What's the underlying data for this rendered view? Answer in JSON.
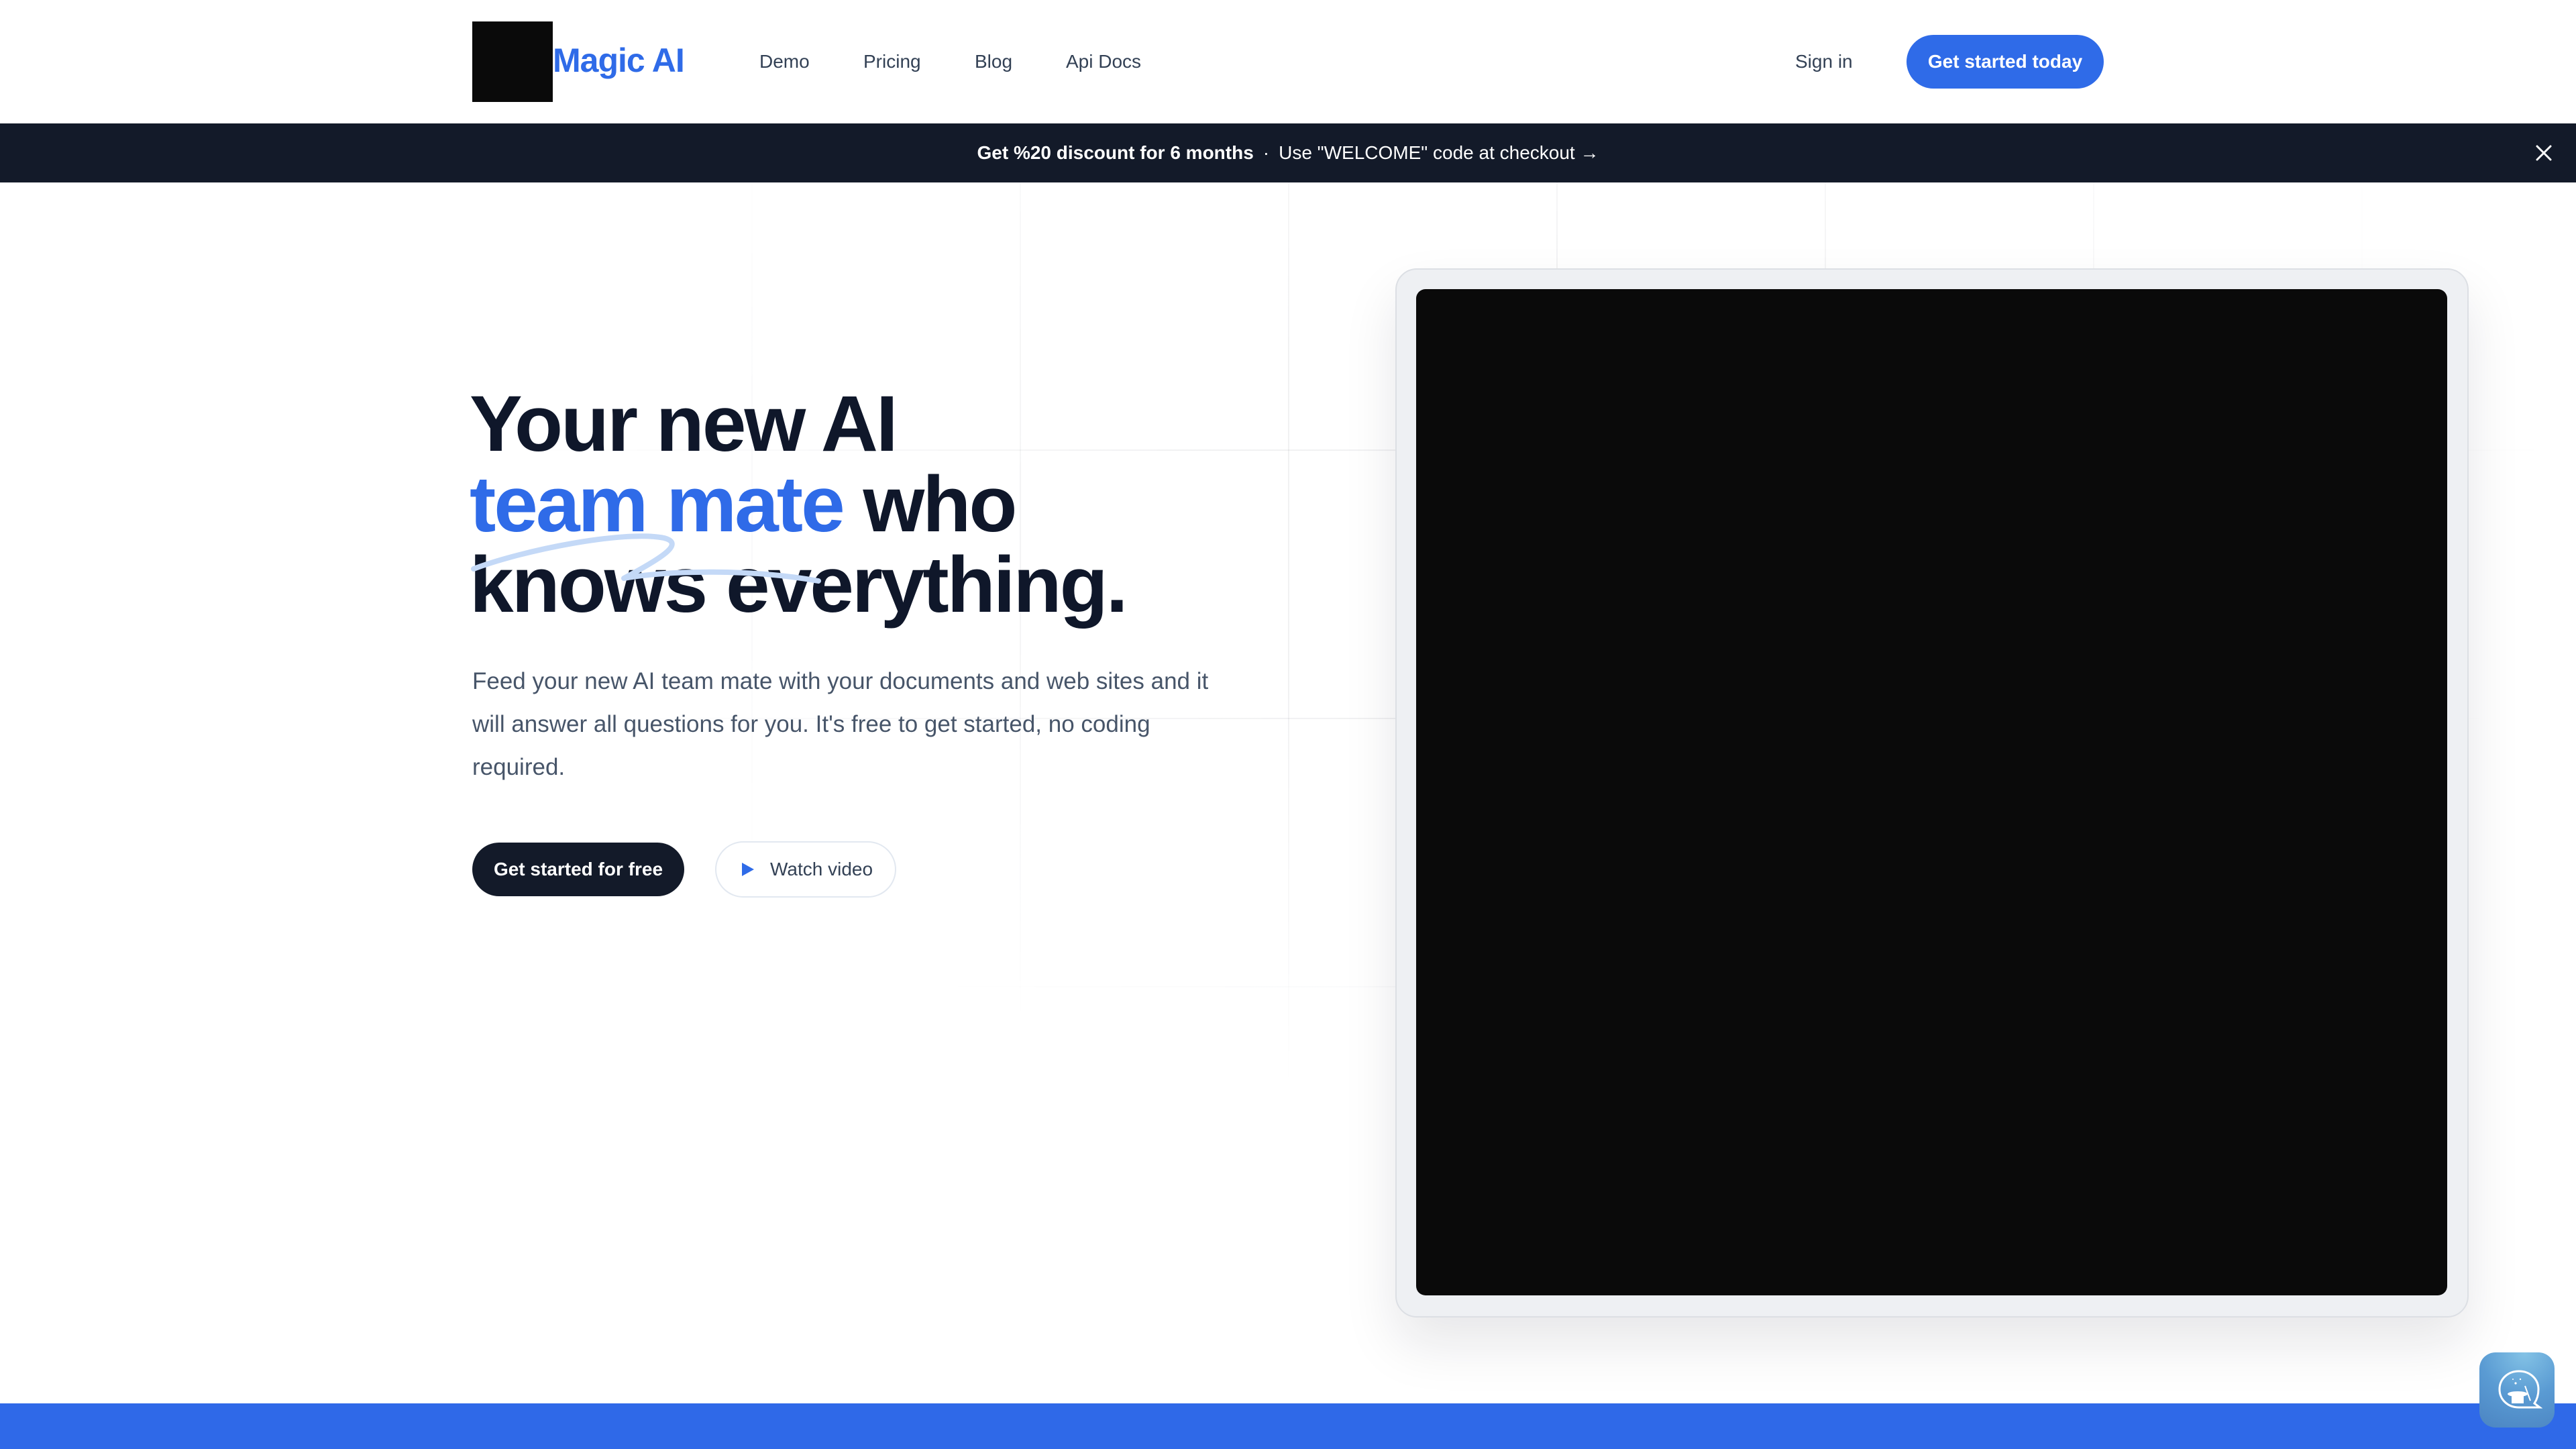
{
  "header": {
    "logo_text": "Magic AI",
    "nav": [
      {
        "label": "Demo"
      },
      {
        "label": "Pricing"
      },
      {
        "label": "Blog"
      },
      {
        "label": "Api Docs"
      }
    ],
    "sign_in": "Sign in",
    "cta": "Get started today"
  },
  "banner": {
    "strong_text": "Get %20 discount for 6 months",
    "separator": "·",
    "text": "Use \"WELCOME\" code at checkout",
    "arrow": "→",
    "close_icon": "close-icon"
  },
  "hero": {
    "title_line1": "Your new AI",
    "title_accent": "team mate",
    "title_line2_rest": " who",
    "title_line3": "knows everything.",
    "description": "Feed your new AI team mate with your documents and web sites and it will answer all questions for you. It's free to get started, no coding required.",
    "primary_button": "Get started for free",
    "secondary_button": "Watch video",
    "secondary_icon": "play-icon"
  },
  "video": {
    "icon": "video-placeholder"
  },
  "chat_widget": {
    "icon": "magic-hat-chat-icon"
  },
  "colors": {
    "accent": "#2f6be8",
    "dark": "#131a29",
    "text": "#0f172a",
    "muted": "#475569",
    "bottom_band": "#2f69e8"
  }
}
